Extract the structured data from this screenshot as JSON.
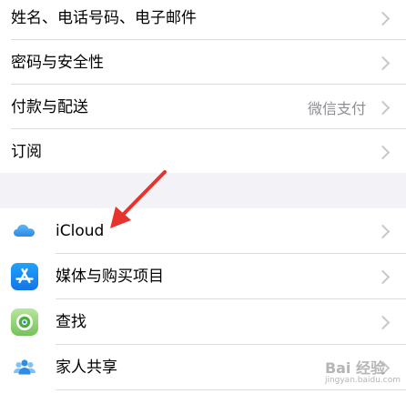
{
  "account_section": {
    "items": [
      {
        "label": "姓名、电话号码、电子邮件",
        "value": ""
      },
      {
        "label": "密码与安全性",
        "value": ""
      },
      {
        "label": "付款与配送",
        "value": "微信支付"
      },
      {
        "label": "订阅",
        "value": ""
      }
    ]
  },
  "services_section": {
    "items": [
      {
        "label": "iCloud",
        "icon": "icloud-icon"
      },
      {
        "label": "媒体与购买项目",
        "icon": "app-store-icon"
      },
      {
        "label": "查找",
        "icon": "find-my-icon"
      },
      {
        "label": "家人共享",
        "icon": "family-sharing-icon"
      }
    ]
  },
  "annotation": {
    "arrow_color": "#e8322c"
  },
  "watermark": {
    "text": "Bai 经验",
    "sub": "jingyan.baidu.com"
  }
}
